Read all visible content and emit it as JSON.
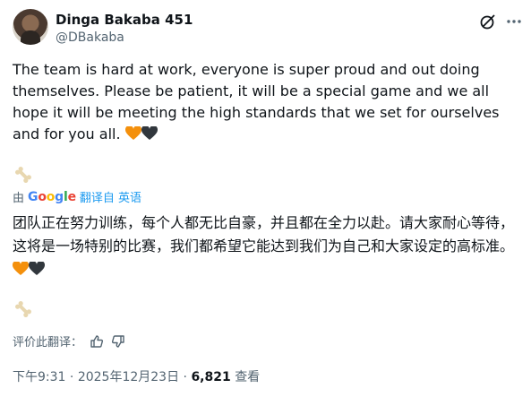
{
  "author": {
    "display_name": "Dinga Bakaba 451",
    "handle": "@DBakaba"
  },
  "tweet": {
    "text": "The team is hard at work, everyone is super proud and out doing themselves.  Please be patient, it will be a special game and we all hope it will be meeting the high standards that we set for ourselves and for you all.",
    "emojis": [
      "orange-heart",
      "black-heart"
    ]
  },
  "translation": {
    "prefix": "由",
    "provider": "Google",
    "translated_from": "翻译自 英语",
    "text": "团队正在努力训练，每个人都无比自豪，并且都在全力以赴。请大家耐心等待，这将是一场特别的比赛，我们都希望它能达到我们为自己和大家设定的高标准。"
  },
  "rating": {
    "label": "评价此翻译："
  },
  "meta": {
    "time": "下午9:31",
    "separator": "·",
    "date": "2025年12月23日",
    "views_count": "6,821",
    "views_label": "查看"
  },
  "icons": {
    "grok": "grok-icon",
    "more": "more-icon",
    "bone": "bone-icon",
    "thumb_up": "thumb-up-icon",
    "thumb_down": "thumb-down-icon"
  },
  "colors": {
    "accent": "#1d9bf0",
    "secondary_text": "#536471",
    "orange_heart": "#f4900c",
    "black_heart": "#31373d"
  }
}
